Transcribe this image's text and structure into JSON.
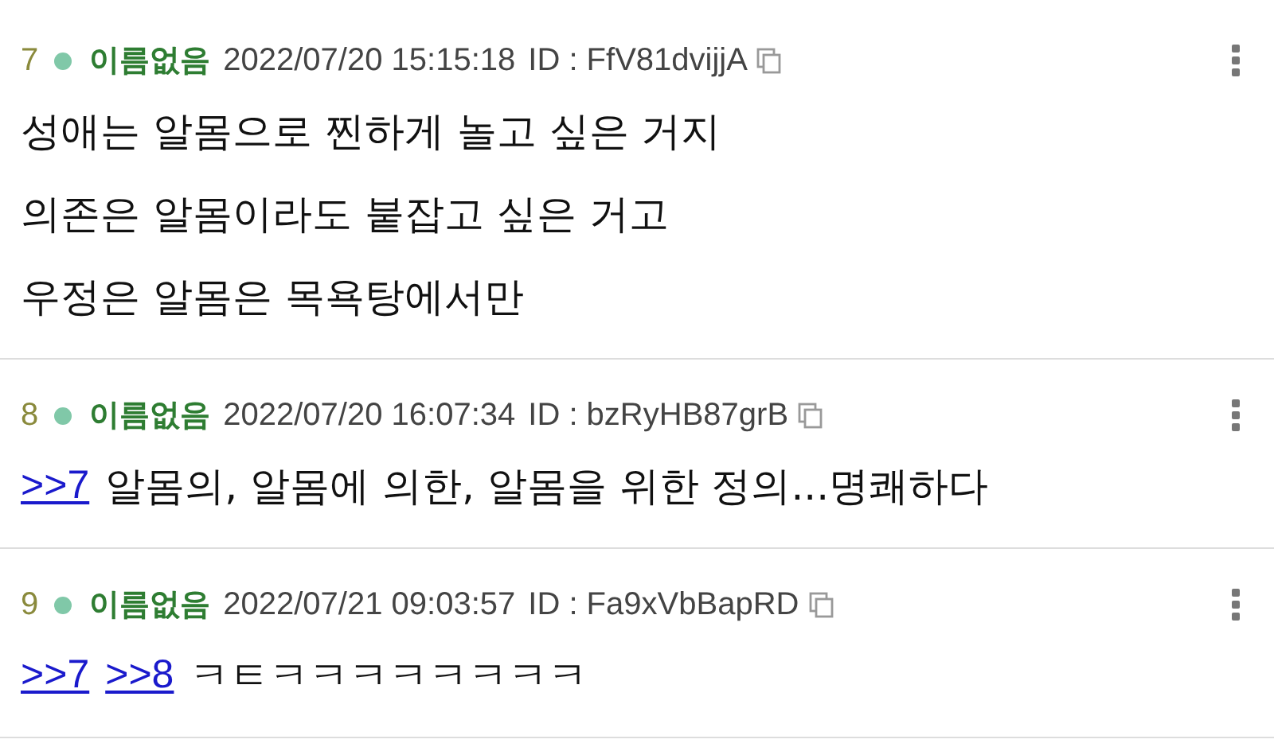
{
  "posts": [
    {
      "number": "7",
      "color": "#80c8a8",
      "name": "이름없음",
      "date": "2022/07/20 15:15:18",
      "id": "ID : FfV81dvijjA",
      "lines": [
        {
          "text": "성애는 알몸으로 찐하게 놀고 싶은 거지"
        },
        {
          "text": "의존은 알몸이라도 붙잡고 싶은 거고"
        },
        {
          "text": "우정은 알몸은 목욕탕에서만"
        }
      ]
    },
    {
      "number": "8",
      "color": "#80c8a8",
      "name": "이름없음",
      "date": "2022/07/20 16:07:34",
      "id": "ID : bzRyHB87grB",
      "lines": [
        {
          "links": [
            ">>7"
          ],
          "text": "알몸의, 알몸에 의한, 알몸을 위한 정의...명쾌하다"
        }
      ]
    },
    {
      "number": "9",
      "color": "#80c8a8",
      "name": "이름없음",
      "date": "2022/07/21 09:03:57",
      "id": "ID : Fa9xVbBapRD",
      "lines": [
        {
          "links": [
            ">>7",
            ">>8"
          ],
          "text": "ㅋㅌㅋㅋㅋㅋㅋㅋㅋㅋ"
        }
      ]
    }
  ]
}
